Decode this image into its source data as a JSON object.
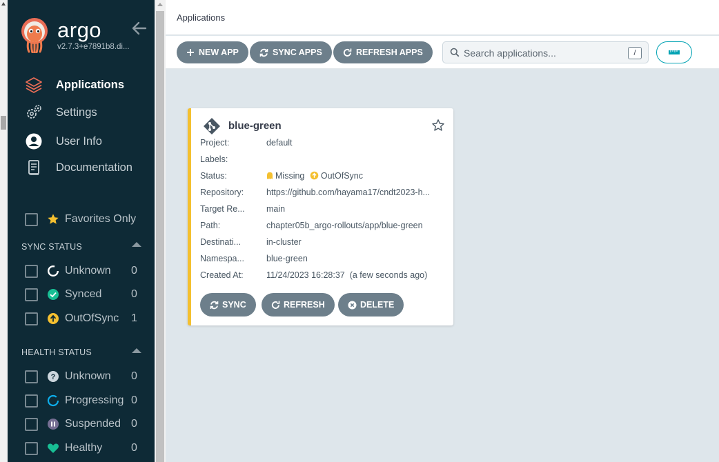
{
  "sidebar": {
    "brand": "argo",
    "version": "v2.7.3+e7891b8.di...",
    "nav": [
      {
        "label": "Applications",
        "icon": "layers-icon",
        "active": true
      },
      {
        "label": "Settings",
        "icon": "gears-icon"
      },
      {
        "label": "User Info",
        "icon": "user-circle-icon"
      },
      {
        "label": "Documentation",
        "icon": "book-icon"
      }
    ],
    "favorites_label": "Favorites Only",
    "sync_status": {
      "title": "SYNC STATUS",
      "items": [
        {
          "label": "Unknown",
          "count": "0",
          "icon": "circle-notch-icon"
        },
        {
          "label": "Synced",
          "count": "0",
          "icon": "check-circle-icon"
        },
        {
          "label": "OutOfSync",
          "count": "1",
          "icon": "arrow-up-circle-icon"
        }
      ]
    },
    "health_status": {
      "title": "HEALTH STATUS",
      "items": [
        {
          "label": "Unknown",
          "count": "0",
          "icon": "question-circle-icon"
        },
        {
          "label": "Progressing",
          "count": "0",
          "icon": "spinner-icon"
        },
        {
          "label": "Suspended",
          "count": "0",
          "icon": "pause-circle-icon"
        },
        {
          "label": "Healthy",
          "count": "0",
          "icon": "heart-icon"
        }
      ]
    }
  },
  "header": {
    "title": "Applications"
  },
  "toolbar": {
    "new_app": "NEW APP",
    "sync_apps": "SYNC APPS",
    "refresh_apps": "REFRESH APPS",
    "search_placeholder": "Search applications...",
    "search_shortcut": "/"
  },
  "app_card": {
    "name": "blue-green",
    "fields": [
      {
        "key": "Project:",
        "value": "default"
      },
      {
        "key": "Labels:",
        "value": ""
      },
      {
        "key": "Status:",
        "value": ""
      },
      {
        "key": "Repository:",
        "value": "https://github.com/hayama17/cndt2023-h..."
      },
      {
        "key": "Target Re...",
        "value": "main"
      },
      {
        "key": "Path:",
        "value": "chapter05b_argo-rollouts/app/blue-green"
      },
      {
        "key": "Destinati...",
        "value": "in-cluster"
      },
      {
        "key": "Namespa...",
        "value": "blue-green"
      },
      {
        "key": "Created At:",
        "value": "11/24/2023 16:28:37  (a few seconds ago)"
      }
    ],
    "health": "Missing",
    "sync": "OutOfSync",
    "buttons": {
      "sync": "SYNC",
      "refresh": "REFRESH",
      "delete": "DELETE"
    }
  },
  "colors": {
    "sidebar_bg": "#0e2a36",
    "button_gray": "#6d7f8b",
    "out_of_sync": "#f4c030",
    "synced": "#18be94",
    "progressing": "#0dadea",
    "suspended": "#766f94",
    "accent_teal": "#00a2b3"
  }
}
